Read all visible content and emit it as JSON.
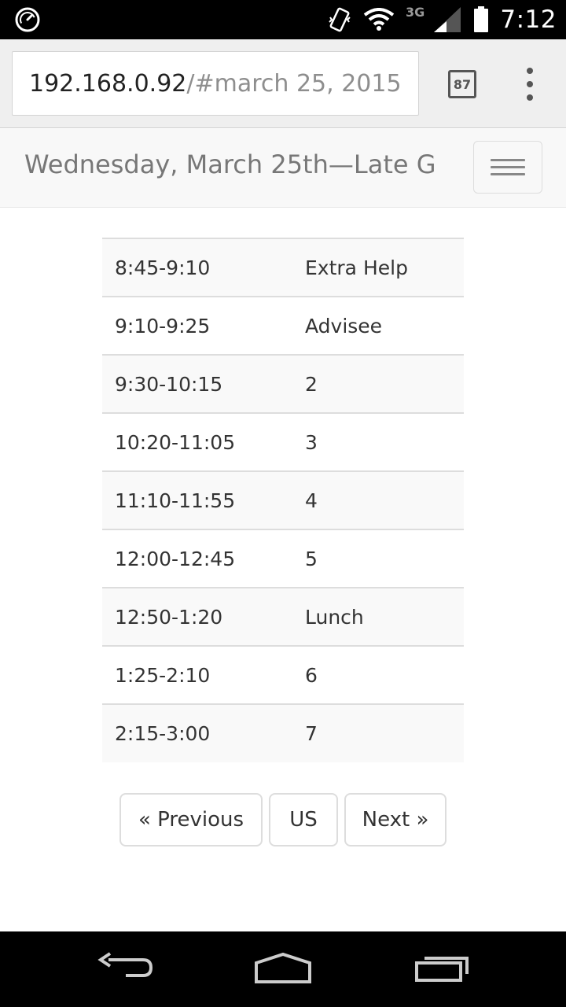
{
  "status_bar": {
    "time": "7:12",
    "network": "3G",
    "icons": [
      "speedometer-icon",
      "vibrate-icon",
      "wifi-icon",
      "signal-icon",
      "battery-icon"
    ]
  },
  "browser": {
    "url_host": "192.168.0.92",
    "url_path": "/#march 25, 2015",
    "tab_count": "87",
    "menu_icon": "overflow-menu-icon"
  },
  "navbar": {
    "brand": "Wednesday, March 25th—Late G",
    "toggle_icon": "hamburger-icon"
  },
  "schedule": {
    "rows": [
      {
        "time": "8:45-9:10",
        "label": "Extra Help"
      },
      {
        "time": "9:10-9:25",
        "label": "Advisee"
      },
      {
        "time": "9:30-10:15",
        "label": "2"
      },
      {
        "time": "10:20-11:05",
        "label": "3"
      },
      {
        "time": "11:10-11:55",
        "label": "4"
      },
      {
        "time": "12:00-12:45",
        "label": "5"
      },
      {
        "time": "12:50-1:20",
        "label": "Lunch"
      },
      {
        "time": "1:25-2:10",
        "label": "6"
      },
      {
        "time": "2:15-3:00",
        "label": "7"
      }
    ]
  },
  "pager": {
    "previous": "« Previous",
    "middle": "US",
    "next": "Next »"
  },
  "nav_bar": {
    "icons": [
      "back-icon",
      "home-icon",
      "recents-icon"
    ]
  },
  "colors": {
    "status_bar": "#000000",
    "chrome_bar": "#efefef",
    "navbar": "#f8f8f8",
    "stripe": "#f9f9f9",
    "text": "#333333",
    "muted": "#777777"
  }
}
